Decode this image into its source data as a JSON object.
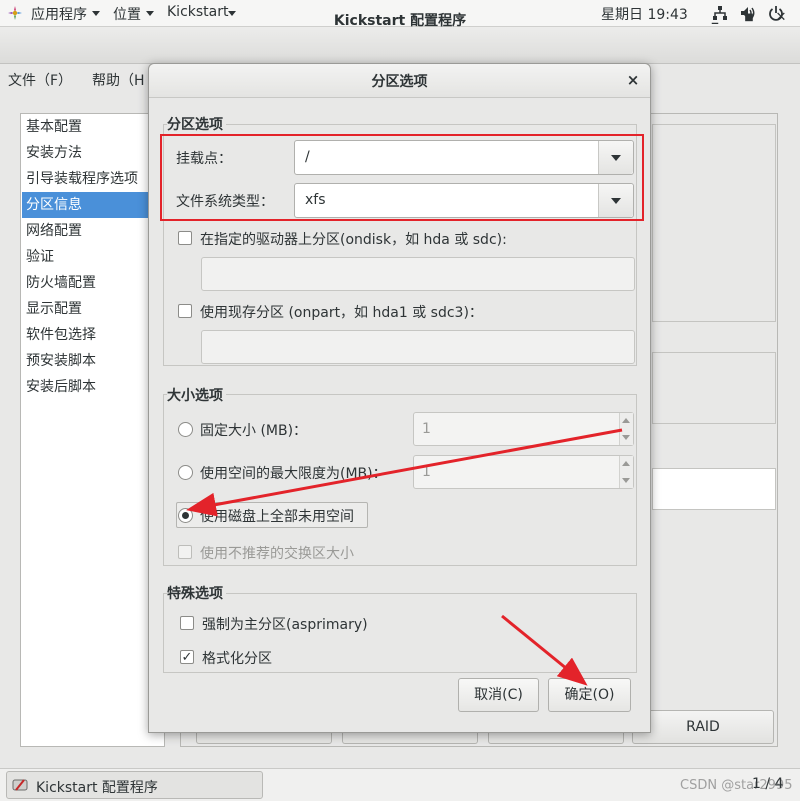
{
  "top_panel": {
    "applications": "应用程序",
    "places": "位置",
    "app_name": "Kickstart",
    "clock": "星期日 19:43"
  },
  "main_window": {
    "title": "Kickstart 配置程序",
    "menu": [
      "文件（F）",
      "帮助（H"
    ],
    "nav_items": [
      "基本配置",
      "安装方法",
      "引导装载程序选项",
      "分区信息",
      "网络配置",
      "验证",
      "防火墙配置",
      "显示配置",
      "软件包选择",
      "预安装脚本",
      "安装后脚本"
    ],
    "selected_nav_index": 3,
    "raid_button": "RAID"
  },
  "dialog": {
    "title": "分区选项",
    "partition_section": {
      "title": "分区选项",
      "mount_point_label": "挂载点：",
      "mount_point_value": "/",
      "fs_type_label": "文件系统类型：",
      "fs_type_value": "xfs",
      "ondisk_label": "在指定的驱动器上分区(ondisk，如 hda 或 sdc):",
      "onpart_label": "使用现存分区 (onpart，如 hda1 或 sdc3)："
    },
    "size_section": {
      "title": "大小选项",
      "fixed_size_label": "固定大小 (MB)：",
      "fixed_size_value": "1",
      "max_size_label": "使用空间的最大限度为(MB)：",
      "max_size_value": "1",
      "fill_disk_label": "使用磁盘上全部未用空间",
      "recommended_swap_label": "使用不推荐的交换区大小",
      "selected_option": "fill_disk"
    },
    "special_section": {
      "title": "特殊选项",
      "asprimary_label": "强制为主分区(asprimary)",
      "asprimary_checked": false,
      "format_label": "格式化分区",
      "format_checked": true
    },
    "cancel_button": "取消(C)",
    "ok_button": "确定(O)"
  },
  "taskbar": {
    "item_label": "Kickstart 配置程序",
    "watermark": "CSDN @star2995",
    "pager": "1 / 4"
  },
  "colors": {
    "selection": "#4a90d9",
    "annotation_red": "#e3232a"
  }
}
